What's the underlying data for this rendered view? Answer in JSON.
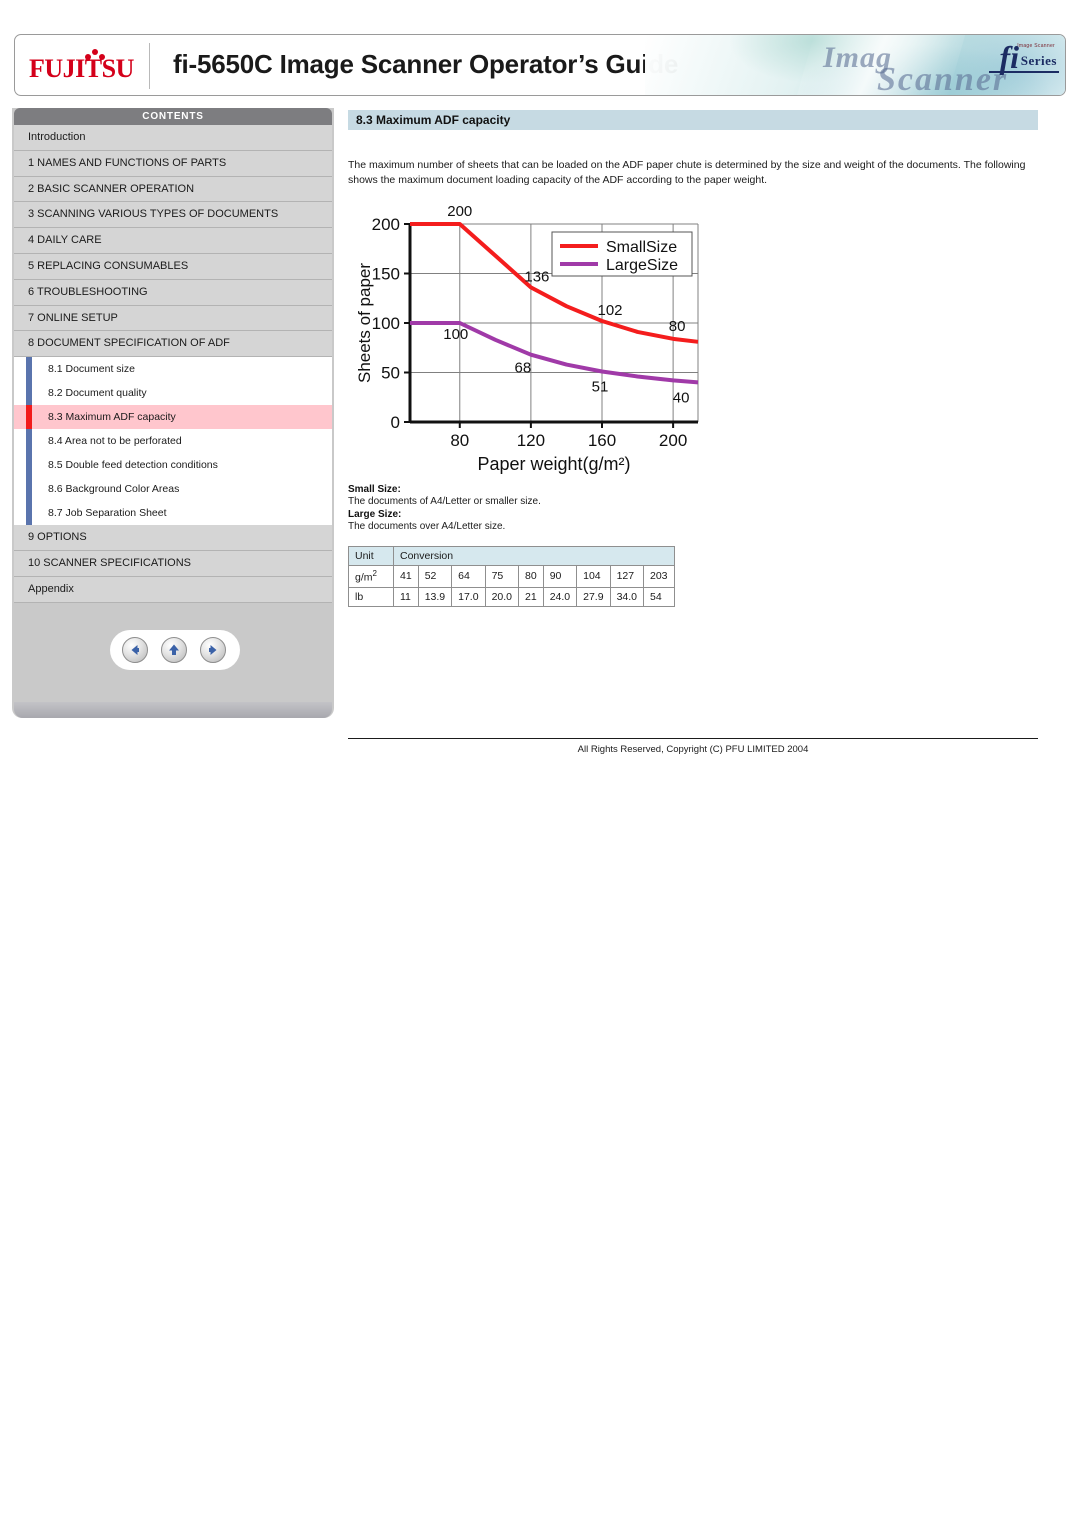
{
  "header": {
    "logo_text": "FUJITSU",
    "title": "fi-5650C Image Scanner Operator’s Guide",
    "art_script_1": "Imag",
    "art_script_2": "Scanner",
    "art_fi": "fi",
    "art_series": "Series",
    "art_series_tiny": "Image Scanner"
  },
  "sidebar": {
    "contents_label": "CONTENTS",
    "items": [
      {
        "label": "Introduction",
        "level": 1,
        "active": false
      },
      {
        "label": "1 NAMES AND FUNCTIONS OF PARTS",
        "level": 1,
        "active": false
      },
      {
        "label": "2 BASIC SCANNER OPERATION",
        "level": 1,
        "active": false
      },
      {
        "label": "3 SCANNING VARIOUS TYPES OF DOCUMENTS",
        "level": 1,
        "active": false
      },
      {
        "label": "4 DAILY CARE",
        "level": 1,
        "active": false
      },
      {
        "label": "5 REPLACING CONSUMABLES",
        "level": 1,
        "active": false
      },
      {
        "label": "6 TROUBLESHOOTING",
        "level": 1,
        "active": false
      },
      {
        "label": "7 ONLINE SETUP",
        "level": 1,
        "active": false
      },
      {
        "label": "8 DOCUMENT SPECIFICATION OF ADF",
        "level": 1,
        "active": false
      },
      {
        "label": "8.1 Document size",
        "level": 2,
        "active": false
      },
      {
        "label": "8.2 Document quality",
        "level": 2,
        "active": false
      },
      {
        "label": "8.3 Maximum ADF capacity",
        "level": 2,
        "active": true
      },
      {
        "label": "8.4 Area not to be perforated",
        "level": 2,
        "active": false
      },
      {
        "label": "8.5 Double feed detection conditions",
        "level": 2,
        "active": false
      },
      {
        "label": "8.6 Background Color Areas",
        "level": 2,
        "active": false
      },
      {
        "label": "8.7 Job Separation Sheet",
        "level": 2,
        "active": false
      },
      {
        "label": "9 OPTIONS",
        "level": 1,
        "active": false
      },
      {
        "label": "10 SCANNER SPECIFICATIONS",
        "level": 1,
        "active": false
      },
      {
        "label": "Appendix",
        "level": 1,
        "active": false
      }
    ],
    "nav_buttons": [
      {
        "name": "back",
        "glyph": "←"
      },
      {
        "name": "up",
        "glyph": "↑"
      },
      {
        "name": "forward",
        "glyph": "→"
      }
    ],
    "accent_active": "#f21a1a",
    "accent_rail": "#5a74ad",
    "accent_active_bg": "#ffc6cd"
  },
  "main": {
    "section_title": "8.3 Maximum ADF capacity",
    "body_paragraph": "The maximum number of sheets that can be loaded on the ADF paper chute is determined by the size and weight of the documents. The following shows the maximum document loading capacity of the ADF according to the paper weight.",
    "notes": [
      {
        "label": "Small Size:",
        "text": "The documents of A4/Letter or smaller size."
      },
      {
        "label": "Large Size:",
        "text": "The documents over A4/Letter size."
      }
    ],
    "table": {
      "header": [
        "Unit",
        "Conversion"
      ],
      "rows": [
        {
          "unit": "g/m",
          "unit_sup": "2",
          "values": [
            "41",
            "52",
            "64",
            "75",
            "80",
            "90",
            "104",
            "127",
            "203"
          ]
        },
        {
          "unit": "lb",
          "unit_sup": "",
          "values": [
            "11",
            "13.9",
            "17.0",
            "20.0",
            "21",
            "24.0",
            "27.9",
            "34.0",
            "54"
          ]
        }
      ]
    }
  },
  "chart_data": {
    "type": "line",
    "title": "",
    "xlabel": "Paper weight(g/m²)",
    "ylabel": "Sheets of paper",
    "xlim": [
      52,
      214
    ],
    "ylim": [
      0,
      200
    ],
    "xticks": [
      80,
      120,
      160,
      200
    ],
    "yticks": [
      0,
      50,
      100,
      150,
      200
    ],
    "grid": true,
    "legend_position": "top-right",
    "series": [
      {
        "name": "SmallSize",
        "color": "#f41d1d",
        "x": [
          52,
          80,
          100,
          120,
          140,
          160,
          180,
          200,
          214
        ],
        "values": [
          200,
          200,
          168,
          136,
          117,
          102,
          91,
          84,
          81
        ],
        "labels": [
          {
            "x": 80,
            "y": 200,
            "text": "200"
          },
          {
            "x": 120,
            "y": 136,
            "text": "136"
          },
          {
            "x": 160,
            "y": 102,
            "text": "102"
          },
          {
            "x": 200,
            "y": 84,
            "text": "80"
          }
        ]
      },
      {
        "name": "LargeSize",
        "color": "#a03aa8",
        "x": [
          52,
          80,
          100,
          120,
          140,
          160,
          180,
          200,
          214
        ],
        "values": [
          100,
          100,
          83,
          68,
          58,
          51,
          46,
          42,
          40
        ],
        "labels": [
          {
            "x": 80,
            "y": 100,
            "text": "100"
          },
          {
            "x": 120,
            "y": 68,
            "text": "68"
          },
          {
            "x": 160,
            "y": 51,
            "text": "51"
          },
          {
            "x": 200,
            "y": 42,
            "text": "40"
          }
        ]
      }
    ]
  },
  "footer": {
    "copyright": "All Rights Reserved, Copyright (C) PFU LIMITED 2004"
  }
}
